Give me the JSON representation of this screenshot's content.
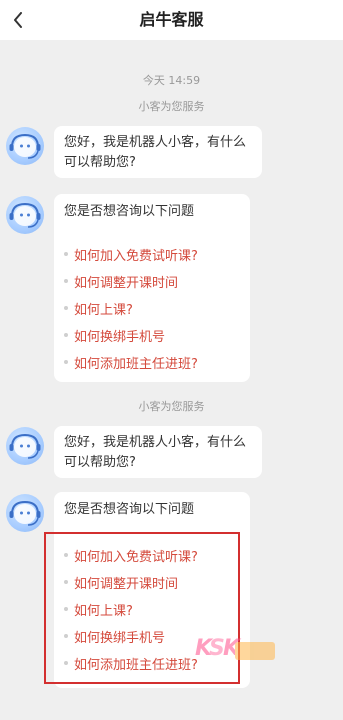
{
  "header": {
    "title": "启牛客服",
    "back_icon": "chevron-left-icon"
  },
  "chat": {
    "timestamp": "今天 14:59",
    "service_notice_1": "小客为您服务",
    "service_notice_2": "小客为您服务",
    "greeting_1": "您好，我是机器人小客，有什么可以帮助您?",
    "greeting_2": "您好，我是机器人小客，有什么可以帮助您?",
    "faq_1": {
      "title": "您是否想咨询以下问题",
      "items": [
        "如何加入免费试听课?",
        "如何调整开课时间",
        "如何上课?",
        "如何换绑手机号",
        "如何添加班主任进班?"
      ]
    },
    "faq_2": {
      "title": "您是否想咨询以下问题",
      "items": [
        "如何加入免费试听课?",
        "如何调整开课时间",
        "如何上课?",
        "如何换绑手机号",
        "如何添加班主任进班?"
      ]
    }
  },
  "colors": {
    "link": "#d44a3c",
    "highlight": "#d32f2f",
    "background": "#efefef"
  }
}
